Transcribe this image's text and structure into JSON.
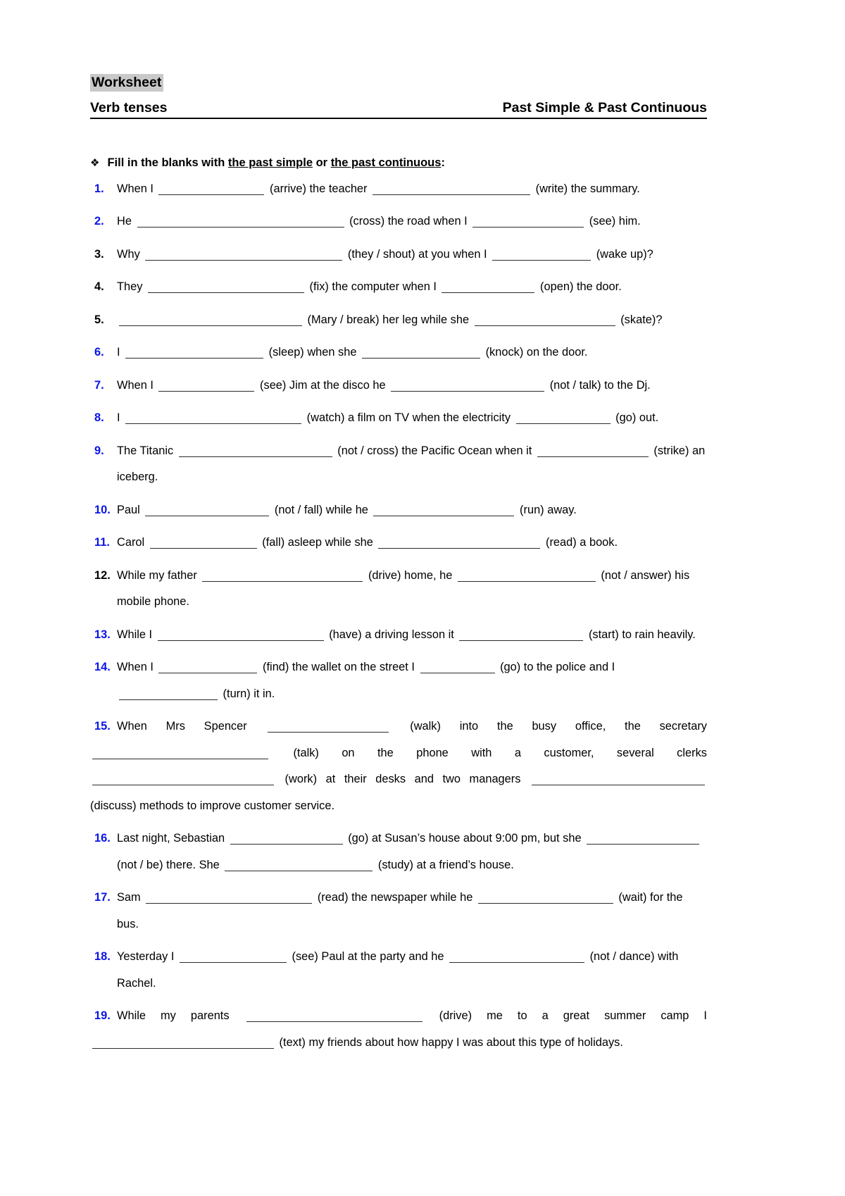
{
  "header": {
    "worksheet_label": "Worksheet",
    "subject": "Verb tenses",
    "topic": "Past Simple & Past Continuous",
    "highlight_color": "#c9c9c9"
  },
  "instruction": {
    "bullet_icon": "diamond-bullet-icon",
    "prefix": "Fill in the blanks with ",
    "em1": "the past simple",
    "mid": " or ",
    "em2": "the past continuous",
    "suffix": ":"
  },
  "style": {
    "number_blue": "#0a14e8",
    "number_black": "#000000"
  },
  "exercises": [
    {
      "n": "1.",
      "color": "blue",
      "justify": false,
      "parts": [
        "When I ",
        "BLANK:150",
        " (arrive) the teacher ",
        "BLANK:224",
        " (write) the summary."
      ]
    },
    {
      "n": "2.",
      "color": "blue",
      "justify": false,
      "parts": [
        "He ",
        "BLANK:294",
        " (cross) the road when I ",
        "BLANK:158",
        " (see) him."
      ]
    },
    {
      "n": "3.",
      "color": "black",
      "justify": false,
      "parts": [
        "Why ",
        "BLANK:280",
        " (they / shout) at you when I ",
        "BLANK:140",
        " (wake up)?"
      ]
    },
    {
      "n": "4.",
      "color": "black",
      "justify": false,
      "parts": [
        "They ",
        "BLANK:222",
        " (fix) the computer when I ",
        "BLANK:132",
        " (open) the door."
      ]
    },
    {
      "n": "5.",
      "color": "black",
      "justify": false,
      "parts": [
        "",
        "BLANK:260",
        " (Mary / break) her leg while she ",
        "BLANK:200",
        " (skate)?"
      ]
    },
    {
      "n": "6.",
      "color": "blue",
      "justify": false,
      "parts": [
        "I ",
        "BLANK:196",
        " (sleep) when she ",
        "BLANK:168",
        " (knock) on the door."
      ]
    },
    {
      "n": "7.",
      "color": "blue",
      "justify": false,
      "parts": [
        "When I ",
        "BLANK:136",
        " (see) Jim at the disco he ",
        "BLANK:218",
        " (not / talk) to the Dj."
      ]
    },
    {
      "n": "8.",
      "color": "blue",
      "justify": false,
      "parts": [
        "I ",
        "BLANK:250",
        " (watch) a film on TV when the electricity ",
        "BLANK:134",
        " (go) out."
      ]
    },
    {
      "n": "9.",
      "color": "blue",
      "justify": false,
      "parts": [
        "The Titanic ",
        "BLANK:218",
        " (not / cross) the Pacific Ocean when it ",
        "BLANK:158",
        " (strike) an iceberg."
      ]
    },
    {
      "n": "10.",
      "color": "blue",
      "justify": false,
      "parts": [
        "Paul ",
        "BLANK:176",
        " (not / fall) while he ",
        "BLANK:200",
        " (run) away."
      ]
    },
    {
      "n": "11.",
      "color": "blue",
      "justify": false,
      "parts": [
        "Carol ",
        "BLANK:152",
        " (fall) asleep while she ",
        "BLANK:230",
        " (read) a book."
      ]
    },
    {
      "n": "12.",
      "color": "black",
      "justify": false,
      "parts": [
        "While my father ",
        "BLANK:228",
        " (drive) home, he ",
        "BLANK:196",
        " (not / answer) his mobile phone."
      ]
    },
    {
      "n": "13.",
      "color": "blue",
      "justify": false,
      "parts": [
        "While I ",
        "BLANK:236",
        " (have) a driving lesson it ",
        "BLANK:176",
        " (start) to rain heavily."
      ]
    },
    {
      "n": "14.",
      "color": "blue",
      "justify": false,
      "parts": [
        "When I ",
        "BLANK:140",
        " (find) the wallet on the street I ",
        "BLANK:106",
        " (go) to the police and I ",
        "BLANK:140",
        " (turn) it in."
      ]
    },
    {
      "n": "15.",
      "color": "blue",
      "justify": true,
      "parts": [
        "When Mrs Spencer ",
        "BLANK:172",
        " (walk) into the busy office, the secretary ",
        "BLANK:250",
        " (talk) on the phone with a customer, several clerks ",
        "BLANK:258",
        " (work) at their desks and two managers ",
        "BLANK:246",
        " (discuss) methods to improve customer service."
      ]
    },
    {
      "n": "16.",
      "color": "blue",
      "justify": false,
      "parts": [
        "Last night, Sebastian ",
        "BLANK:160",
        " (go) at Susan’s house about 9:00 pm, but she ",
        "BLANK:160",
        " (not / be) there. She ",
        "BLANK:210",
        " (study) at a friend’s house."
      ]
    },
    {
      "n": "17.",
      "color": "blue",
      "justify": false,
      "parts": [
        "Sam ",
        "BLANK:236",
        " (read) the newspaper while he ",
        "BLANK:192",
        " (wait) for the bus."
      ]
    },
    {
      "n": "18.",
      "color": "blue",
      "justify": false,
      "parts": [
        "Yesterday I ",
        "BLANK:152",
        " (see) Paul at the party and he ",
        "BLANK:192",
        " (not / dance) with Rachel."
      ]
    },
    {
      "n": "19.",
      "color": "blue",
      "justify": true,
      "parts": [
        "While my parents ",
        "BLANK:250",
        " (drive) me to a great summer camp I ",
        "BLANK:258",
        " (text) my friends about how happy I was about this type of holidays."
      ]
    }
  ]
}
